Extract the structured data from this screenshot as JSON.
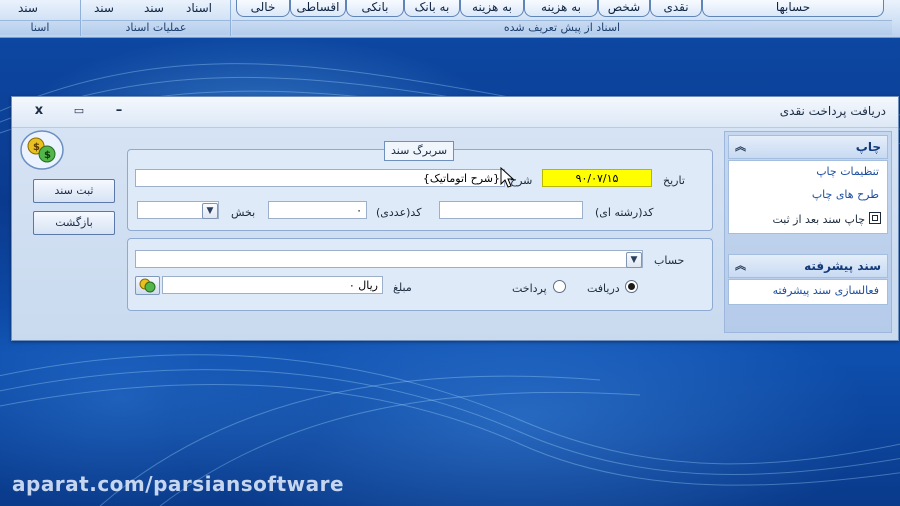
{
  "ribbon": {
    "group1": {
      "buttons": [
        "سند"
      ],
      "label": "اسنا"
    },
    "group2": {
      "buttons": [
        "اسناد",
        "سند",
        "سند"
      ],
      "label": "عملیات اسناد"
    },
    "group3": {
      "tabs": [
        "حسابها",
        "نقدی",
        "شخص",
        "به هزینه",
        "به هزینه",
        "به بانک",
        "بانکی",
        "اقساطی",
        "خالی"
      ],
      "label": "اسناد از پیش تعریف شده"
    }
  },
  "window": {
    "title": "دریافت پرداخت نقدی",
    "close_glyph": "x",
    "restore_glyph": "▭",
    "minimize_glyph": "–"
  },
  "side_panel": {
    "print_section": {
      "header": "چاپ",
      "print_settings_link": "تنظیمات چاپ",
      "print_designs_link": "طرح های چاپ",
      "print_after_save_label": "چاپ سند بعد از ثبت"
    },
    "advanced_section": {
      "header": "سند پیشرفته",
      "activate_link": "فعالسازی سند پیشرفته"
    }
  },
  "header_box": {
    "title": "سربرگ سند",
    "date_label": "تاریخ",
    "date_value": "۹۰/۰۷/۱۵",
    "description_label": "شرح",
    "description_value": "{شرح اتوماتیک}",
    "code_string_label": "کد(رشته ای)",
    "code_string_value": "",
    "code_numeric_label": "کد(عددی)",
    "code_numeric_value": "۰",
    "section_label": "بخش",
    "section_value": ""
  },
  "detail_box": {
    "account_label": "حساب",
    "account_value": "",
    "receive_label": "دریافت",
    "pay_label": "پرداخت",
    "selected": "receive",
    "amount_label": "مبلغ",
    "amount_value": "ریال ۰"
  },
  "buttons": {
    "save_label": "ثبت سند",
    "back_label": "بازگشت"
  },
  "watermark": "aparat.com/parsiansoftware",
  "colors": {
    "desktop": "#0b3f8c",
    "date_highlight": "#ffff00",
    "link": "#1f4fa0"
  }
}
